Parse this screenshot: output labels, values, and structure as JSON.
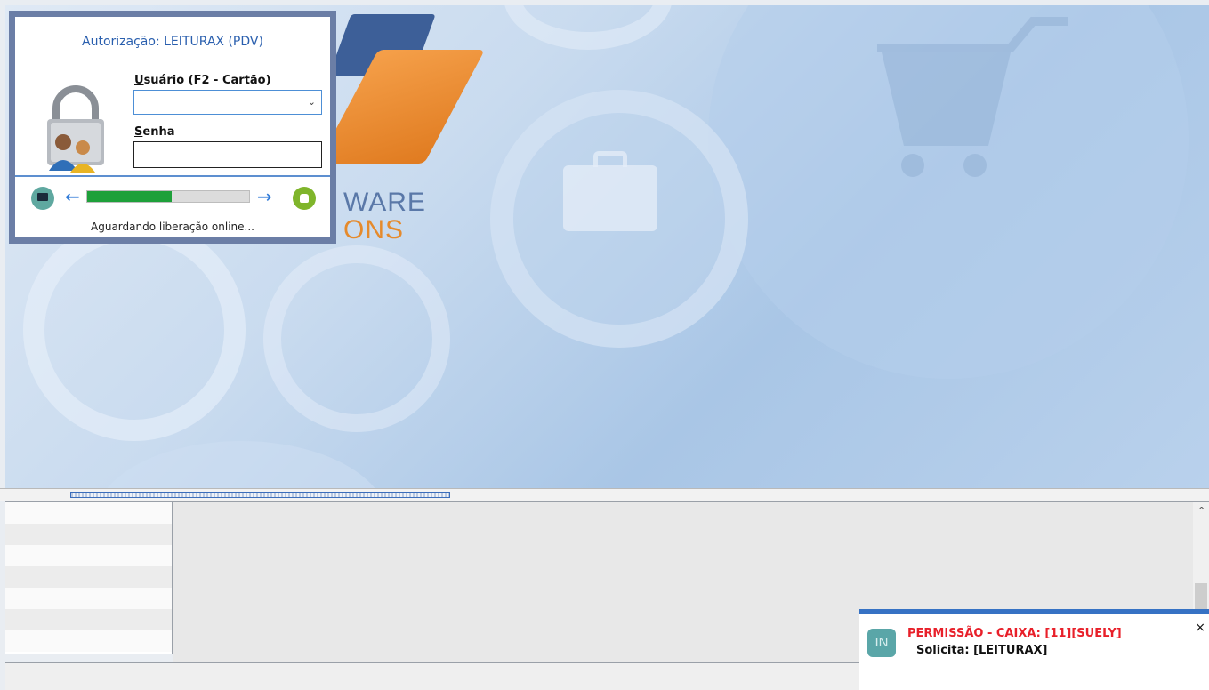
{
  "dialog": {
    "title": "Autorização: LEITURAX (PDV)",
    "user_label_underlined": "U",
    "user_label_rest": "suário (F2 - Cartão)",
    "user_value": "",
    "pass_label_underlined": "S",
    "pass_label_rest": "enha",
    "pass_value": "",
    "progress_percent": 52,
    "status": "Aguardando liberação online..."
  },
  "background": {
    "logo_line1": "WARE",
    "logo_line2": "ONS"
  },
  "notification": {
    "icon_text": "IN",
    "title": "PERMISSÃO - CAIXA: [11][SUELY]",
    "subtitle": "Solicita: [LEITURAX]",
    "close": "×"
  },
  "icons": {
    "combo_arrow": "⌄",
    "scroll_up": "^",
    "arrow_left": "←",
    "arrow_right": "→"
  },
  "colors": {
    "accent": "#3672c4",
    "progress": "#1ea03a",
    "alert": "#e8202a"
  }
}
